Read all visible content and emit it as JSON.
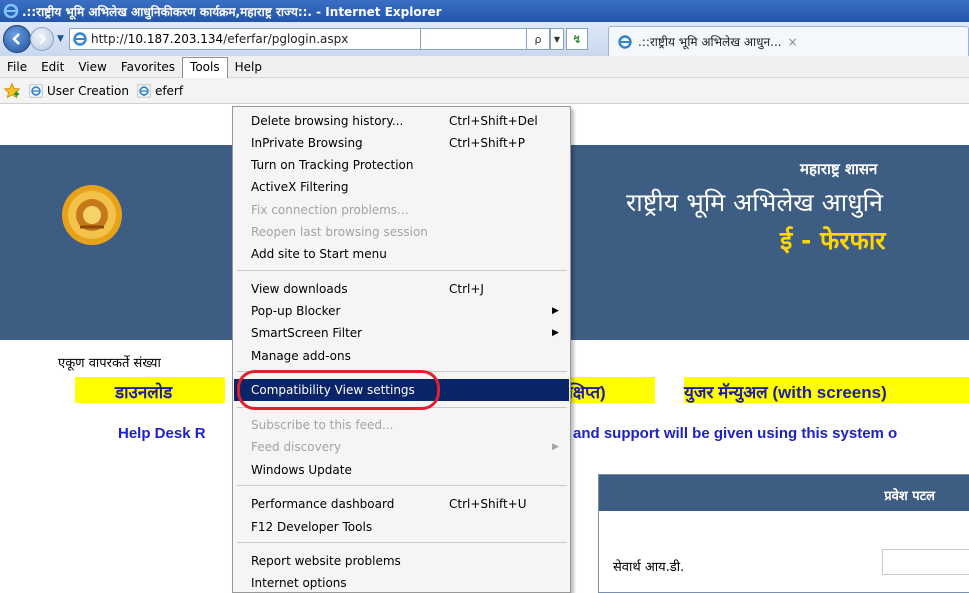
{
  "window": {
    "title": ".::राष्ट्रीय भूमि अभिलेख आधुनिकीकरण कार्यक्रम,महाराष्ट्र राज्य::. - Internet Explorer"
  },
  "address": {
    "url_prefix": "http://",
    "url_host": "10.187.203.134",
    "url_path": "/eferfar/pglogin.aspx",
    "search_symbol": "ρ",
    "drop_symbol": "▼",
    "refresh_symbol": "↯",
    "tab_title": ".::राष्ट्रीय भूमि अभिलेख आधुन...",
    "tab_close": "×"
  },
  "menubar": {
    "items": [
      "File",
      "Edit",
      "View",
      "Favorites",
      "Tools",
      "Help"
    ]
  },
  "favorites": {
    "items": [
      "User Creation",
      "eferf"
    ]
  },
  "page": {
    "gov": "महाराष्ट्र शासन",
    "dept": "राष्ट्रीय भूमि अभिलेख आधुनि",
    "app": "ई  - फेरफार",
    "users_count_label": "एकूण वापरकर्ते संख्या",
    "download": "डाउनलोड",
    "short_manual": "संक्षिप्त)",
    "user_manual": "युजर मॅन्युअल (with screens)",
    "helpdesk": "Help Desk R",
    "support": "and support will be given using this system o",
    "login_title": "प्रवेश पटल",
    "login_id_label": "सेवार्थ आय.डी."
  },
  "tools_menu": {
    "items": [
      {
        "label": "Delete browsing history...",
        "shortcut": "Ctrl+Shift+Del"
      },
      {
        "label": "InPrivate Browsing",
        "shortcut": "Ctrl+Shift+P"
      },
      {
        "label": "Turn on Tracking Protection",
        "shortcut": ""
      },
      {
        "label": "ActiveX Filtering",
        "shortcut": ""
      },
      {
        "label": "Fix connection problems...",
        "shortcut": ""
      },
      {
        "label": "Reopen last browsing session",
        "shortcut": ""
      },
      {
        "label": "Add site to Start menu",
        "shortcut": ""
      },
      {
        "label": "View downloads",
        "shortcut": "Ctrl+J"
      },
      {
        "label": "Pop-up Blocker",
        "shortcut": ""
      },
      {
        "label": "SmartScreen Filter",
        "shortcut": ""
      },
      {
        "label": "Manage add-ons",
        "shortcut": ""
      },
      {
        "label": "Compatibility View settings",
        "shortcut": ""
      },
      {
        "label": "Subscribe to this feed...",
        "shortcut": ""
      },
      {
        "label": "Feed discovery",
        "shortcut": ""
      },
      {
        "label": "Windows Update",
        "shortcut": ""
      },
      {
        "label": "Performance dashboard",
        "shortcut": "Ctrl+Shift+U"
      },
      {
        "label": "F12 Developer Tools",
        "shortcut": ""
      },
      {
        "label": "Report website problems",
        "shortcut": ""
      },
      {
        "label": "Internet options",
        "shortcut": ""
      }
    ]
  },
  "colors": {
    "title_bar": "#2456a8",
    "banner": "#3e5d83",
    "menu_selected": "#0a246a",
    "highlight_ring": "#e0222c",
    "link_yellow": "#ffff00"
  }
}
